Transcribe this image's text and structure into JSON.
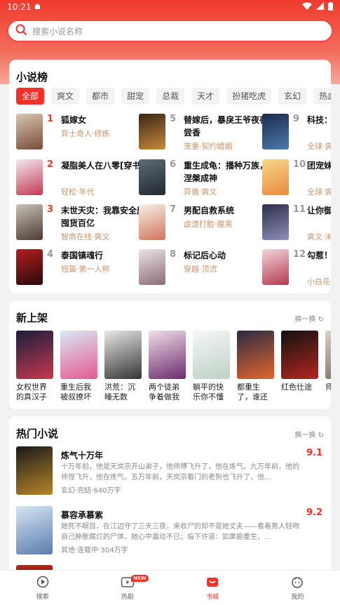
{
  "status_bar": {
    "time": "10:21"
  },
  "search": {
    "placeholder": "搜索小说名称"
  },
  "rank": {
    "title": "小说榜",
    "tabs": [
      "全部",
      "爽文",
      "都市",
      "甜宠",
      "总裁",
      "天才",
      "扮猪吃虎",
      "玄幻",
      "热血"
    ],
    "items": [
      {
        "num": "1",
        "title": "狐嫁女",
        "tag": "异士奇人·修炼",
        "cover": [
          "#d9c7b2",
          "#7a4b3a"
        ]
      },
      {
        "num": "2",
        "title": "凝脂美人在八零[穿书]",
        "tag": "轻松·年代",
        "cover": [
          "#f4e8ee",
          "#c23a55"
        ]
      },
      {
        "num": "3",
        "title": "末世天灾：我靠安全屋囤货百亿",
        "tag": "智商在线·爽文",
        "cover": [
          "#c9c2b6",
          "#4c3b32"
        ]
      },
      {
        "num": "4",
        "title": "泰国镇魂行",
        "tag": "短篇·第一人称",
        "cover": [
          "#b31e1e",
          "#2a0a0a"
        ]
      },
      {
        "num": "5",
        "title": "替嫁后，暴戾王爷夜夜尝香",
        "tag": "宠妻·契约婚姻",
        "cover": [
          "#3a2418",
          "#c98a3a"
        ]
      },
      {
        "num": "6",
        "title": "重生成龟：播种万族，涅槃成神",
        "tag": "异兽·爽文",
        "cover": [
          "#5d6b73",
          "#202a30"
        ]
      },
      {
        "num": "7",
        "title": "男配自救系统",
        "tag": "虐渣打脸·腹黑",
        "cover": [
          "#f7efe6",
          "#d2765c"
        ]
      },
      {
        "num": "8",
        "title": "标记后心动",
        "tag": "穿越·顶流",
        "cover": [
          "#ece3e6",
          "#8b6b7a"
        ]
      },
      {
        "num": "9",
        "title": "科技：开局控核聚变",
        "tag": "全球·爽文",
        "cover": [
          "#1c2a48",
          "#4d7ab0"
        ]
      },
      {
        "num": "10",
        "title": "团宠妹妹是全球大佬",
        "tag": "全球·爽文",
        "cover": [
          "#f6d88a",
          "#e9893b"
        ]
      },
      {
        "num": "11",
        "title": "让你御兽你契约天使",
        "tag": "爽文·末世",
        "cover": [
          "#2e2f4a",
          "#8d8fb8"
        ]
      },
      {
        "num": "12",
        "title": "勾惹！让疯批强制爱",
        "tag": "小白花·病娇",
        "cover": [
          "#f1d6dc",
          "#b4384f"
        ]
      }
    ]
  },
  "new_arrivals": {
    "title": "新上架",
    "more": "换一换",
    "items": [
      {
        "title": "女权世界的真汉子",
        "cover": [
          "#1b1e3c",
          "#c7384d"
        ]
      },
      {
        "title": "重生后我被叔撩坏了",
        "cover": [
          "#d9e8f6",
          "#e45a8f"
        ]
      },
      {
        "title": "洪荒：沉睡无数年，醒",
        "cover": [
          "#e8e8e8",
          "#343434"
        ]
      },
      {
        "title": "两个徒弟争着做我的",
        "cover": [
          "#f2dee8",
          "#6a2c6e"
        ]
      },
      {
        "title": "躺平的快乐你不懂",
        "cover": [
          "#f6f7f8",
          "#bcd1c3"
        ]
      },
      {
        "title": "都重生了，谁还",
        "cover": [
          "#2b2a44",
          "#e3662e"
        ]
      },
      {
        "title": "红色仕途",
        "cover": [
          "#111111",
          "#b3261e"
        ]
      },
      {
        "title": "师难",
        "cover": [
          "#d8d2c8",
          "#7a6a5a"
        ]
      }
    ]
  },
  "hot": {
    "title": "热门小说",
    "more": "换一换",
    "items": [
      {
        "title": "炼气十万年",
        "score": "9.1",
        "desc": "十万年前，他是天岚宗开山弟子，他师傅飞升了，他在炼气。九万年前，他的师侄飞升，他在炼气。五万年前，天岚宗看门的老狗也飞升了，他...",
        "tag": "玄幻·完结·640万字",
        "cover": [
          "#1a1a1a",
          "#b8852a"
        ]
      },
      {
        "title": "慕容承慕紫",
        "score": "9.2",
        "desc": "她死不瞑目，在江边守了三天三夜，来收尸的却不是她丈夫——看着男人轻吻自己肿胀腐烂的尸体，她心中震动不已；临下许诺：如果能重生，...",
        "tag": "其他·连载中·304万字",
        "cover": [
          "#d6e6f3",
          "#5a7cae"
        ]
      }
    ]
  },
  "bottom_nav": {
    "items": [
      {
        "label": "搜索"
      },
      {
        "label": "热剧",
        "badge": "NEW"
      },
      {
        "label": "书城"
      },
      {
        "label": "我的"
      }
    ]
  },
  "colors": {
    "accent": "#f0322a",
    "tag": "#c8946a"
  }
}
